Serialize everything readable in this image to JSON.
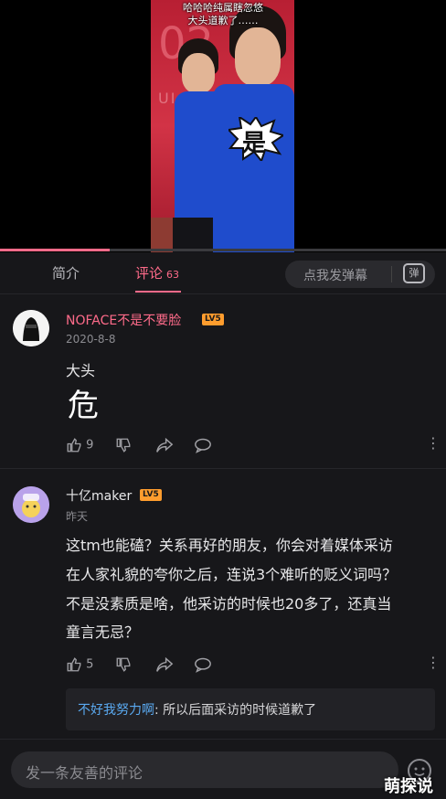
{
  "video": {
    "subtitle_top": "哈哈哈纯属瞎忽悠",
    "subtitle_second": "大头道歉了……",
    "sticker_text": "是",
    "progress": 0.245
  },
  "tabs": {
    "intro_label": "简介",
    "comments_label": "评论",
    "comments_count": "63",
    "danmaku_placeholder": "点我发弹幕",
    "danmaku_icon_text": "弹"
  },
  "comments": [
    {
      "username": "NOFACE不是不要脸",
      "level": "LV5",
      "date": "2020-8-8",
      "text_lines": [
        "大头",
        "🚨"
      ],
      "likes": "9",
      "username_color": "#ff6b8a"
    },
    {
      "username": "十亿maker",
      "level": "LV5",
      "date": "昨天",
      "text_lines": [
        "这tm也能磕？关系再好的朋友，你会对着媒体采访",
        "在人家礼貌的夸你之后，连说3个难听的贬义词吗？",
        "不是没素质是啥，他采访的时候也20多了，还真当",
        "童言无忌？"
      ],
      "likes": "5",
      "reply": {
        "user": "不好我努力啊",
        "text": ": 所以后面采访的时候道歉了"
      }
    }
  ],
  "sticker_char": "危",
  "input": {
    "placeholder": "发一条友善的评论"
  },
  "watermark": "萌探说",
  "colors": {
    "accent": "#ff6b8a",
    "reply_user": "#5aa9f0",
    "level_badge": "#ff9d2e"
  }
}
